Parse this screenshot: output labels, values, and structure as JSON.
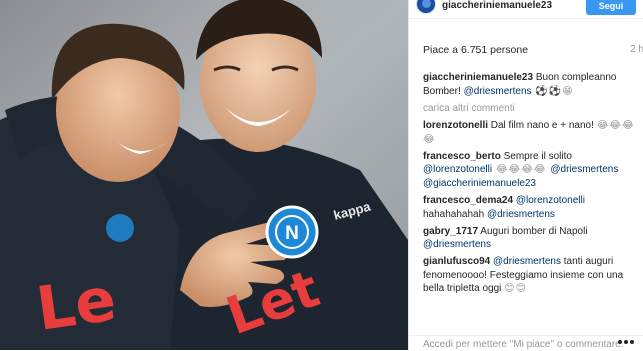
{
  "header": {
    "username": "giaccheriniemanuele23",
    "follow_label": "Segui"
  },
  "likes": {
    "text": "Piace a 6.751 persone",
    "time": "2 h"
  },
  "comments": [
    {
      "user": "giaccheriniemanuele23",
      "parts": [
        {
          "t": "text",
          "v": " Buon compleanno Bomber! "
        },
        {
          "t": "mention",
          "v": "@driesmertens"
        },
        {
          "t": "emoji",
          "v": " ⚽⚽😁"
        }
      ]
    },
    {
      "load_more": "carica altri commenti"
    },
    {
      "user": "lorenzotonelli",
      "parts": [
        {
          "t": "text",
          "v": " Dal film nano e + nano! "
        },
        {
          "t": "emoji",
          "v": "😂😂😂😂"
        }
      ]
    },
    {
      "user": "francesco_berto",
      "parts": [
        {
          "t": "text",
          "v": " Sempre il solito "
        },
        {
          "t": "mention",
          "v": "@lorenzotonelli"
        },
        {
          "t": "emoji",
          "v": " 😂😂😂😂 "
        },
        {
          "t": "mention",
          "v": "@driesmertens"
        },
        {
          "t": "text",
          "v": " "
        },
        {
          "t": "mention",
          "v": "@giaccheriniemanuele23"
        }
      ]
    },
    {
      "user": "francesco_dema24",
      "parts": [
        {
          "t": "text",
          "v": " "
        },
        {
          "t": "mention",
          "v": "@lorenzotonelli"
        },
        {
          "t": "text",
          "v": " hahahahahah "
        },
        {
          "t": "mention",
          "v": "@driesmertens"
        }
      ]
    },
    {
      "user": "gabry_1717",
      "parts": [
        {
          "t": "text",
          "v": " Auguri bomber di Napoli "
        },
        {
          "t": "mention",
          "v": "@driesmertens"
        }
      ]
    },
    {
      "user": "gianlufusco94",
      "parts": [
        {
          "t": "text",
          "v": " "
        },
        {
          "t": "mention",
          "v": "@driesmertens"
        },
        {
          "t": "text",
          "v": " tanti auguri fenomenoooo! Festeggiamo insieme con una bella tripletta oggi "
        },
        {
          "t": "emoji",
          "v": "😊😊"
        }
      ]
    }
  ],
  "footer": {
    "login_text": "Accedi per mettere \"Mi piace\" o commentare.",
    "more_icon": "three-dots-icon"
  },
  "photo": {
    "jersey_text_left": "Le",
    "jersey_text_right": "Let",
    "crest_letter": "N",
    "sponsor": "kappa"
  },
  "colors": {
    "follow_button": "#3897f0",
    "mention": "#003569",
    "muted": "#999999",
    "jersey": "#1c2530",
    "sponsor_red": "#e83d3d",
    "napoli_blue": "#1e88d8"
  }
}
